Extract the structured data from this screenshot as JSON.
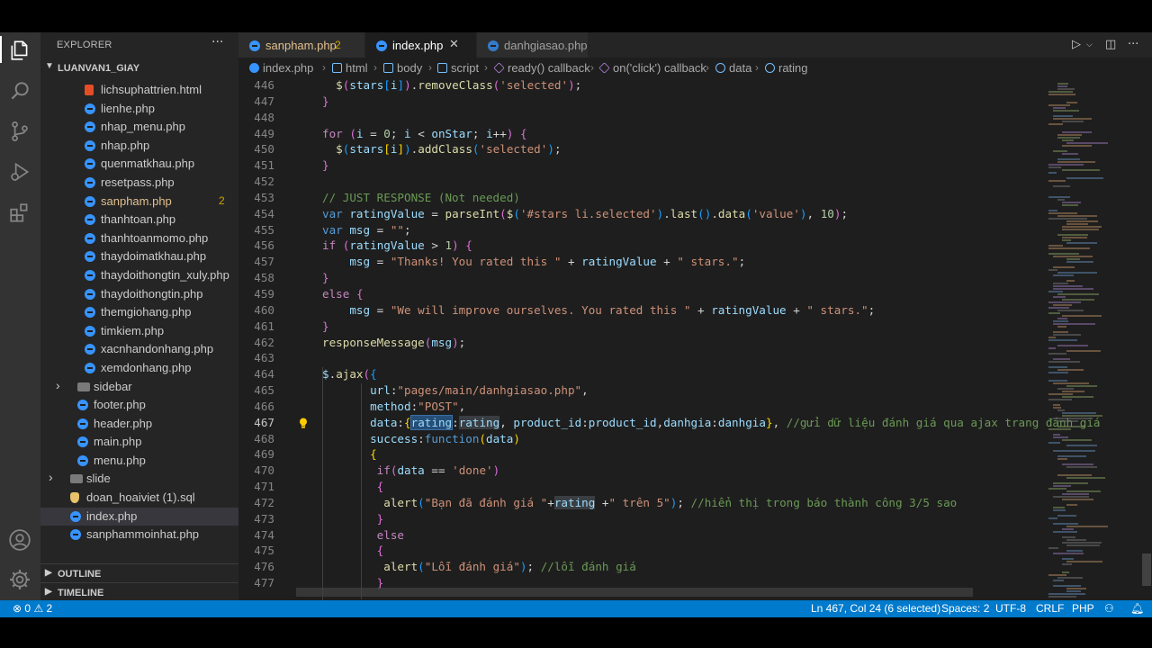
{
  "sidebar": {
    "title": "EXPLORER",
    "more": "···",
    "folder": "LUANVAN1_GIAY",
    "files": [
      {
        "name": "lichsuphattrien.html",
        "type": "html",
        "indent": 2
      },
      {
        "name": "lienhe.php",
        "type": "php",
        "indent": 2
      },
      {
        "name": "nhap_menu.php",
        "type": "php",
        "indent": 2
      },
      {
        "name": "nhap.php",
        "type": "php",
        "indent": 2
      },
      {
        "name": "quenmatkhau.php",
        "type": "php",
        "indent": 2
      },
      {
        "name": "resetpass.php",
        "type": "php",
        "indent": 2
      },
      {
        "name": "sanpham.php",
        "type": "php",
        "indent": 2,
        "modified": true,
        "badge": "2"
      },
      {
        "name": "thanhtoan.php",
        "type": "php",
        "indent": 2
      },
      {
        "name": "thanhtoanmomo.php",
        "type": "php",
        "indent": 2
      },
      {
        "name": "thaydoimatkhau.php",
        "type": "php",
        "indent": 2
      },
      {
        "name": "thaydoithongtin_xuly.php",
        "type": "php",
        "indent": 2
      },
      {
        "name": "thaydoithongtin.php",
        "type": "php",
        "indent": 2
      },
      {
        "name": "themgiohang.php",
        "type": "php",
        "indent": 2
      },
      {
        "name": "timkiem.php",
        "type": "php",
        "indent": 2
      },
      {
        "name": "xacnhandonhang.php",
        "type": "php",
        "indent": 2
      },
      {
        "name": "xemdonhang.php",
        "type": "php",
        "indent": 2
      },
      {
        "name": "sidebar",
        "type": "folder",
        "indent": 1
      },
      {
        "name": "footer.php",
        "type": "php",
        "indent": 1
      },
      {
        "name": "header.php",
        "type": "php",
        "indent": 1
      },
      {
        "name": "main.php",
        "type": "php",
        "indent": 1
      },
      {
        "name": "menu.php",
        "type": "php",
        "indent": 1
      },
      {
        "name": "slide",
        "type": "folder",
        "indent": 0
      },
      {
        "name": "doan_hoaiviet (1).sql",
        "type": "sql",
        "indent": 0
      },
      {
        "name": "index.php",
        "type": "php",
        "indent": 0,
        "selected": true
      },
      {
        "name": "sanphammoinhat.php",
        "type": "php",
        "indent": 0
      }
    ],
    "outline": "OUTLINE",
    "timeline": "TIMELINE"
  },
  "tabs": [
    {
      "label": "sanpham.php",
      "badge": "2",
      "modified": true
    },
    {
      "label": "index.php",
      "active": true,
      "close": "✕"
    },
    {
      "label": "danhgiasao.php"
    }
  ],
  "breadcrumb": [
    "index.php",
    "html",
    "body",
    "script",
    "ready() callback",
    "on('click') callback",
    "data",
    "rating"
  ],
  "editor": {
    "current_line": 467
  },
  "status": {
    "errors": "0",
    "warnings": "2",
    "position": "Ln 467, Col 24 (6 selected)",
    "spaces": "Spaces: 2",
    "encoding": "UTF-8",
    "eol": "CRLF",
    "language": "PHP"
  },
  "colors": {
    "statusbar": "#007acc",
    "editor_bg": "#1e1e1e",
    "sidebar_bg": "#252526",
    "activity_bg": "#333333"
  }
}
